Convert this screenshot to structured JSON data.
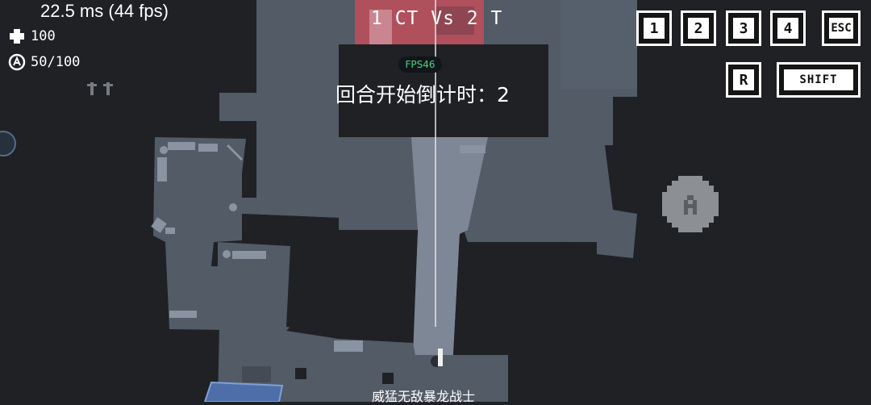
{
  "hud": {
    "perf": "22.5 ms (44 fps)",
    "health": "100",
    "armor": "50/100",
    "score": "1 CT Vs 2 T",
    "fps_badge": "FPS46",
    "countdown": "回合开始倒计时：2",
    "player_name": "威猛无敌暴龙战士"
  },
  "keys": {
    "k1": "1",
    "k2": "2",
    "k3": "3",
    "k4": "4",
    "esc": "ESC",
    "r": "R",
    "shift": "SHIFT"
  },
  "icons": {
    "health": "cross-icon",
    "armor": "shield-icon",
    "action": "a-button-icon",
    "players": "player-figures-icon"
  },
  "colors": {
    "background": "#1f2125",
    "floor": "#535b67",
    "floor_light": "#7e8795",
    "ct_zone": "#b0505d",
    "fps_text": "#49d17a",
    "water": "#4d6ea8"
  }
}
